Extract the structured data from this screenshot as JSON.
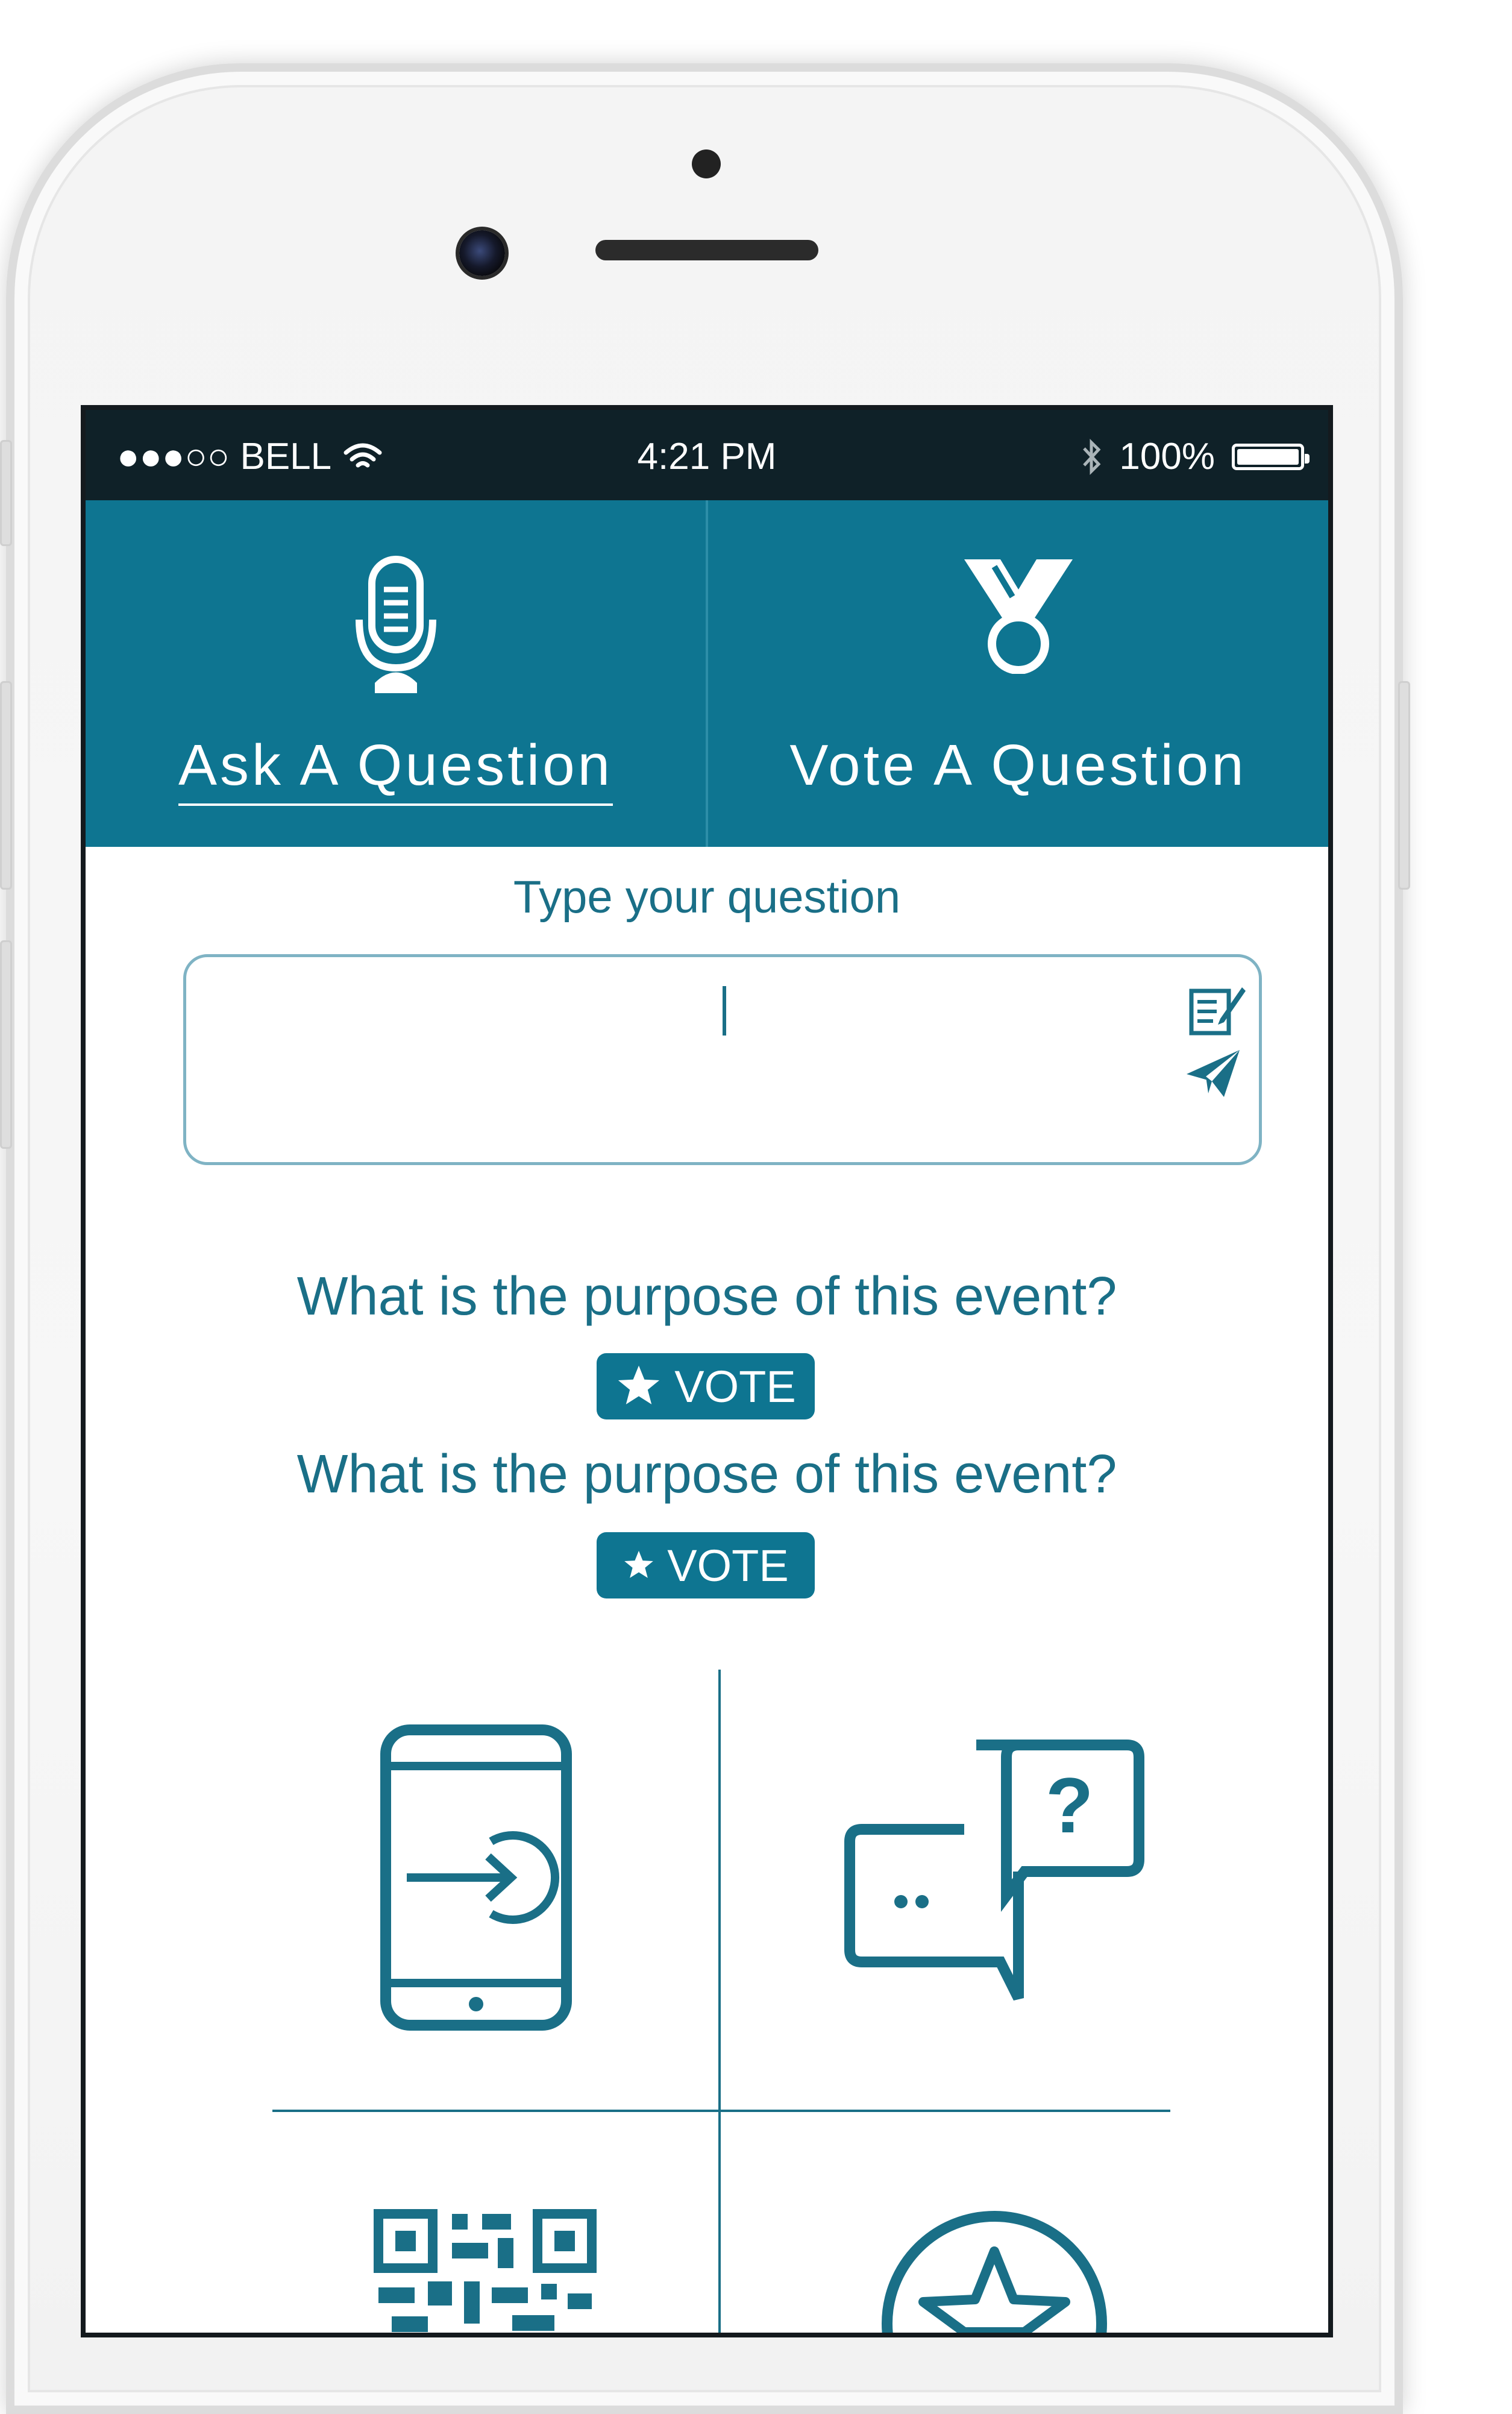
{
  "status_bar": {
    "carrier": "●●●○○ BELL",
    "time": "4:21 PM",
    "battery": "100%"
  },
  "tabs": [
    {
      "label": "Ask A Question",
      "icon": "microphone-icon",
      "active": true
    },
    {
      "label": "Vote A Question",
      "icon": "medal-icon",
      "active": false
    }
  ],
  "ask": {
    "prompt": "Type your question",
    "input_value": ""
  },
  "questions": [
    {
      "text": "What is the purpose of this event?",
      "vote_label": "VOTE"
    },
    {
      "text": "What is the purpose of this event?",
      "vote_label": "VOTE"
    }
  ],
  "feature_tiles": [
    {
      "icon": "phone-login-icon"
    },
    {
      "icon": "chat-question-icon"
    },
    {
      "icon": "qr-code-icon"
    },
    {
      "icon": "star-badge-icon"
    }
  ],
  "colors": {
    "accent": "#0e7591",
    "text_accent": "#1a6f87",
    "status_bar": "#0f2128"
  }
}
